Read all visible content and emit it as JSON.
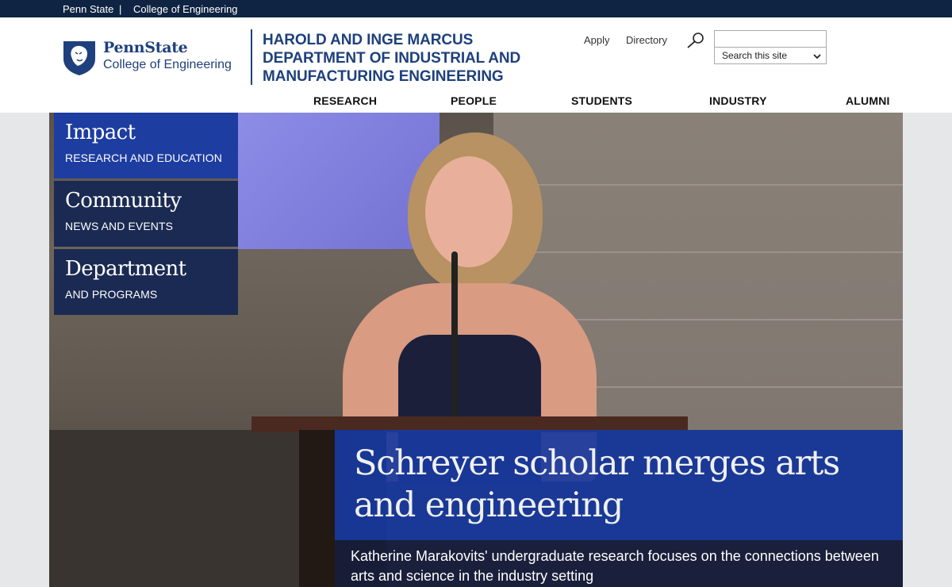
{
  "topbar": {
    "penn_state": "Penn State",
    "separator": "|",
    "college": "College of Engineering"
  },
  "logo": {
    "brand": "PennState",
    "college": "College of Engineering"
  },
  "department": {
    "line1": "HAROLD AND INGE MARCUS",
    "line2": "DEPARTMENT OF INDUSTRIAL AND",
    "line3": "MANUFACTURING ENGINEERING"
  },
  "utility": {
    "apply": "Apply",
    "directory": "Directory"
  },
  "search": {
    "value": "",
    "scope": "Search this site"
  },
  "nav": {
    "items": [
      "RESEARCH",
      "PEOPLE",
      "STUDENTS",
      "INDUSTRY",
      "ALUMNI"
    ]
  },
  "tiles": [
    {
      "title": "Impact",
      "subtitle": "RESEARCH AND EDUCATION"
    },
    {
      "title": "Community",
      "subtitle": "NEWS AND EVENTS"
    },
    {
      "title": "Department",
      "subtitle": "AND PROGRAMS"
    }
  ],
  "feature": {
    "headline": "Schreyer scholar merges arts and engineering",
    "summary": "Katherine Marakovits' undergraduate research focuses on the connections between arts and science in the industry setting"
  },
  "colors": {
    "navy": "#0f2342",
    "psu_blue": "#1e407c",
    "tile": "#1b2a52",
    "tile_active": "#1e3da0"
  }
}
